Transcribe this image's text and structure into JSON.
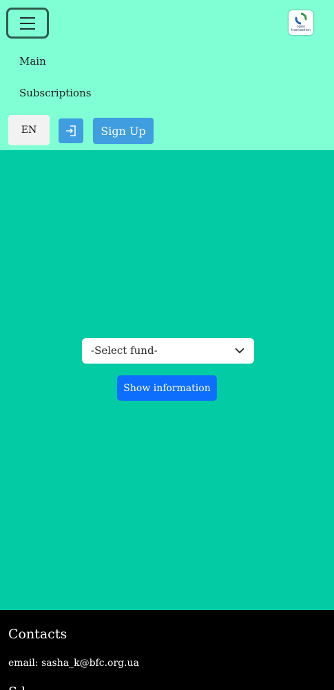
{
  "nav": {
    "items": [
      "Main",
      "Subscriptions"
    ],
    "lang_label": "EN",
    "signup_label": "Sign Up",
    "logo": {
      "line1": "open",
      "line2": "transaction"
    }
  },
  "fund": {
    "select_value": "-Select fund-",
    "button_label": "Show information"
  },
  "footer": {
    "title": "Contacts",
    "email": "email: sasha_k@bfc.org.ua",
    "cut_text": "S l"
  },
  "colors": {
    "navbar": "#80ffd4",
    "page": "#03cba4",
    "accent": "#3f9de0",
    "primary": "#0d6efd",
    "footer": "#000000"
  }
}
